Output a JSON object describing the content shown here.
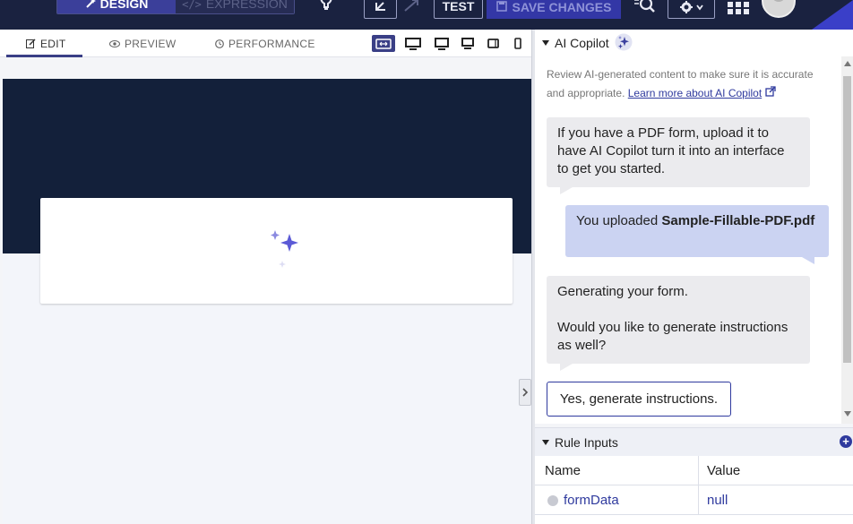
{
  "topbar": {
    "design_label": "DESIGN",
    "expression_label": "EXPRESSION",
    "test_label": "TEST",
    "save_label": "SAVE CHANGES"
  },
  "editor": {
    "tabs": [
      {
        "label": "EDIT",
        "active": true
      },
      {
        "label": "PREVIEW",
        "active": false
      },
      {
        "label": "PERFORMANCE",
        "active": false
      }
    ]
  },
  "copilot": {
    "title": "AI Copilot",
    "notice_text": "Review AI-generated content to make sure it is accurate and appropriate.",
    "notice_link": "Learn more about AI Copilot",
    "messages": [
      {
        "role": "ai",
        "text": "If you have a PDF form, upload it to have AI Copilot turn it into an interface to get you started."
      },
      {
        "role": "user",
        "prefix": "You uploaded ",
        "filename": "Sample-Fillable-PDF.pdf"
      },
      {
        "role": "ai",
        "line1": "Generating your form.",
        "line2": "Would you like to generate instructions as well?"
      }
    ],
    "suggestion": "Yes, generate instructions."
  },
  "rule_inputs": {
    "title": "Rule Inputs",
    "columns": [
      "Name",
      "Value"
    ],
    "rows": [
      {
        "name": "formData",
        "value": "null"
      }
    ]
  },
  "colors": {
    "topbar": "#1a2240",
    "accent": "#3a3f86",
    "link": "#2f3a9e",
    "canvas_dark": "#13203a"
  }
}
